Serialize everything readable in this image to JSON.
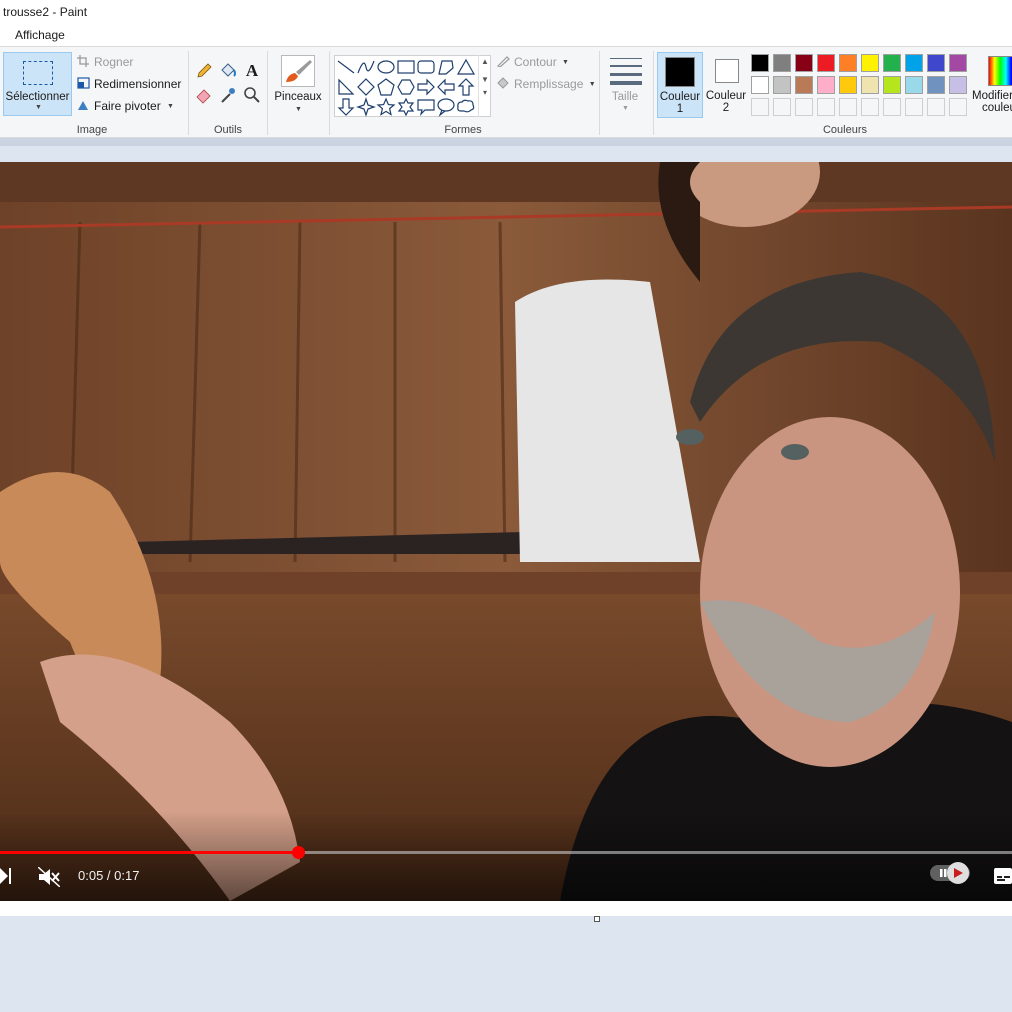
{
  "window": {
    "title": "trousse2 - Paint"
  },
  "menu": {
    "tab_view": "Affichage"
  },
  "ribbon": {
    "image_group": {
      "label": "Image",
      "select": "Sélectionner",
      "crop": "Rogner",
      "resize": "Redimensionner",
      "rotate": "Faire pivoter"
    },
    "tools_group": {
      "label": "Outils"
    },
    "brushes": {
      "label": "Pinceaux"
    },
    "shapes_group": {
      "label": "Formes",
      "outline": "Contour",
      "fill": "Remplissage"
    },
    "size": {
      "label": "Taille"
    },
    "colors_group": {
      "label": "Couleurs",
      "color1_line1": "Couleur",
      "color1_line2": "1",
      "color2_line1": "Couleur",
      "color2_line2": "2",
      "edit_line1": "Modifier",
      "edit_line2": "couleurs",
      "color1_value": "#000000",
      "color2_value": "#ffffff",
      "palette_row1": [
        "#000000",
        "#7f7f7f",
        "#880015",
        "#ed1c24",
        "#ff7f27",
        "#fff200",
        "#22b14c",
        "#00a2e8",
        "#3f48cc",
        "#a349a4"
      ],
      "palette_row2": [
        "#ffffff",
        "#c3c3c3",
        "#b97a57",
        "#ffaec9",
        "#ffc90e",
        "#efe4b0",
        "#b5e61d",
        "#99d9ea",
        "#7092be",
        "#c8bfe7"
      ]
    }
  },
  "player": {
    "time": "0:05 / 0:17",
    "progress_fraction": 0.294
  }
}
